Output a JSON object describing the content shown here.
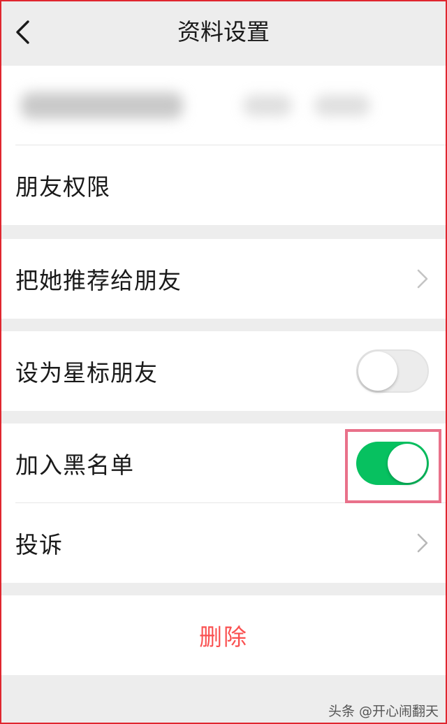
{
  "header": {
    "title": "资料设置"
  },
  "groups": [
    {
      "items": [
        {
          "label": "朋友权限"
        }
      ]
    },
    {
      "items": [
        {
          "label": "把她推荐给朋友",
          "control": "chevron"
        }
      ]
    },
    {
      "items": [
        {
          "label": "设为星标朋友",
          "control": "toggle",
          "checked": false
        }
      ]
    },
    {
      "items": [
        {
          "label": "加入黑名单",
          "control": "toggle",
          "checked": true
        },
        {
          "label": "投诉",
          "control": "chevron"
        }
      ]
    }
  ],
  "delete_label": "删除",
  "watermark": "头条 @开心闹翻天",
  "colors": {
    "toggle_on": "#07c160",
    "danger": "#fa5151",
    "highlight": "#e9718a",
    "frame": "#e0262f"
  },
  "icons": {
    "back": "back-icon",
    "chevron": "chevron-right-icon"
  }
}
